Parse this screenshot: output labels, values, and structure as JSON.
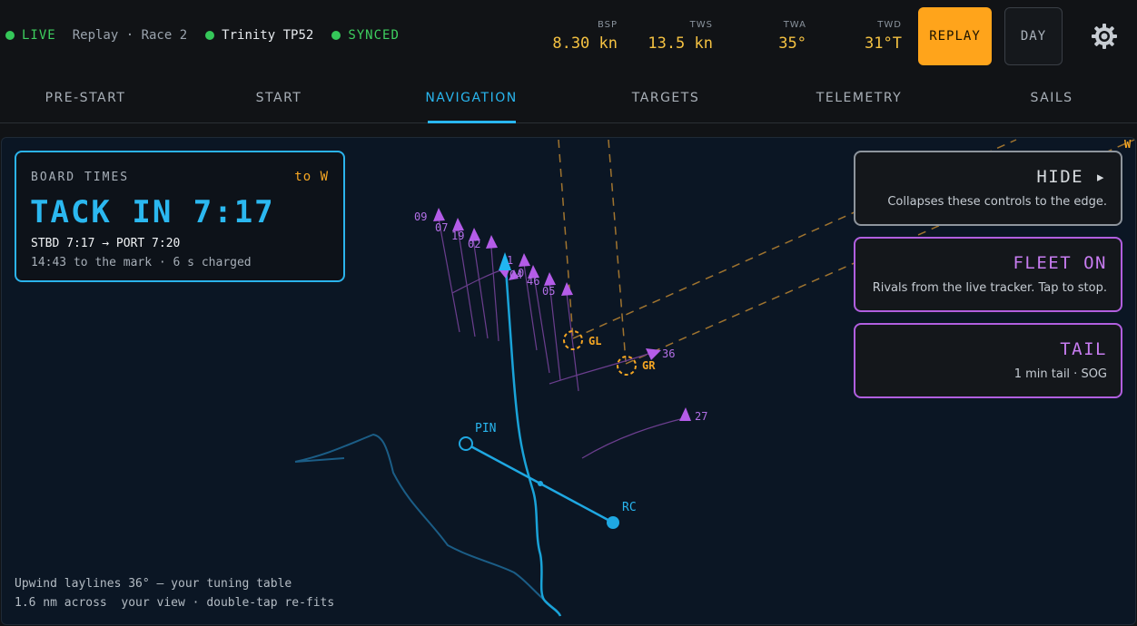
{
  "status": {
    "live": "LIVE",
    "session": "Replay · Race 2",
    "boat": "Trinity TP52",
    "sync": "SYNCED"
  },
  "metrics": [
    {
      "label": "BSP",
      "value": "8.30 kn"
    },
    {
      "label": "TWS",
      "value": "13.5 kn"
    },
    {
      "label": "TWA",
      "value": "35°"
    },
    {
      "label": "TWD",
      "value": "31°T"
    }
  ],
  "buttons": {
    "replay": "REPLAY",
    "day": "DAY"
  },
  "tabs": [
    "PRE-START",
    "START",
    "NAVIGATION",
    "TARGETS",
    "TELEMETRY",
    "SAILS"
  ],
  "active_tab": "NAVIGATION",
  "board_times": {
    "title": "BOARD TIMES",
    "destination": "to W",
    "headline": "TACK IN 7:17",
    "split": "STBD 7:17 → PORT 7:20",
    "mark": "14:43 to the mark · 6 s charged"
  },
  "controls": {
    "hide": {
      "label": "HIDE ▸",
      "desc": "Collapses these controls to the edge."
    },
    "fleet": {
      "label": "FLEET ON",
      "desc": "Rivals from the live tracker. Tap to stop."
    },
    "tail": {
      "label": "TAIL",
      "desc": "1 min tail · SOG"
    }
  },
  "map": {
    "marks": [
      "GL",
      "GR",
      "W"
    ],
    "start_line": [
      "PIN",
      "RC"
    ],
    "rivals": [
      "09",
      "07",
      "19",
      "02",
      "1",
      "04",
      "0",
      "46",
      "05",
      "36",
      "27"
    ]
  },
  "footer": {
    "line1": "Upwind laylines 36° — your tuning table",
    "line2": "1.6 nm across  your view · double-tap re-fits"
  },
  "colors": {
    "accent": "#29b6ef",
    "live": "#35c759",
    "metric": "#f5c242",
    "replay": "#ffa41b",
    "rival": "#b15fe0",
    "mark": "#f5a623"
  }
}
